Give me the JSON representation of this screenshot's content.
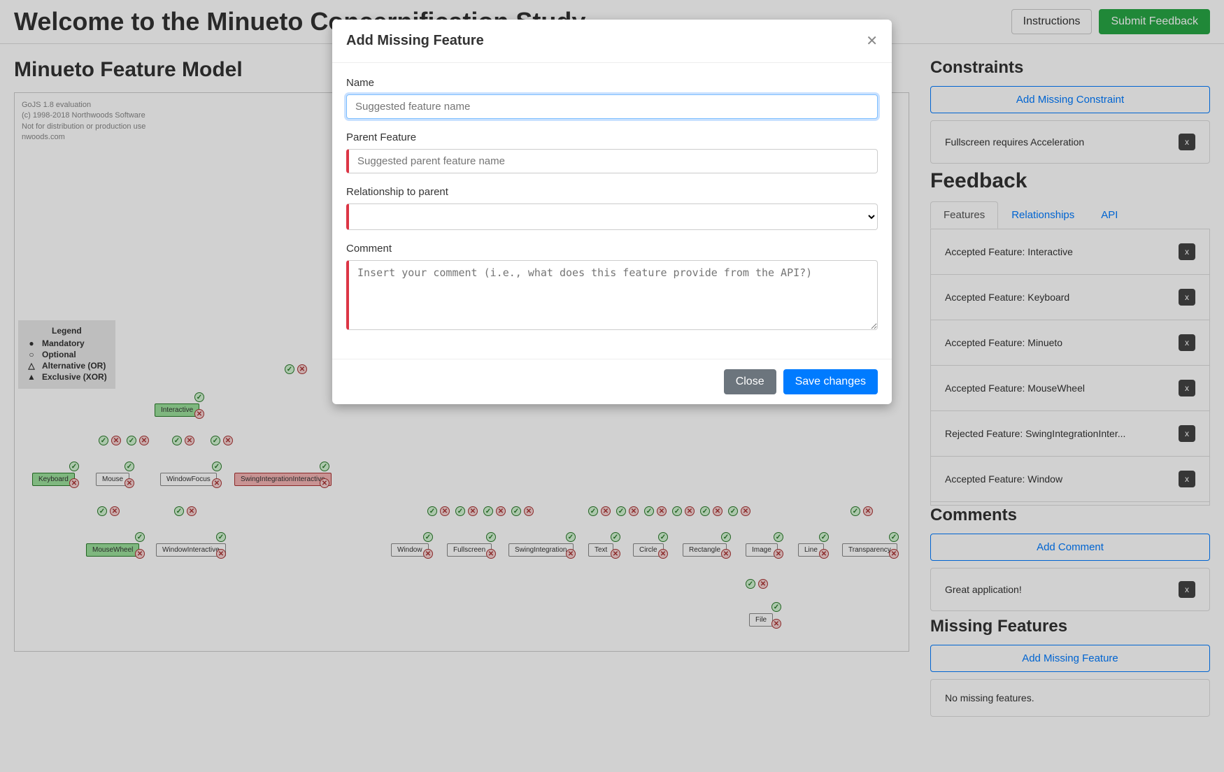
{
  "header": {
    "title": "Welcome to the Minueto Concernification Study",
    "instructions": "Instructions",
    "submit": "Submit Feedback"
  },
  "main": {
    "title": "Minueto Feature Model",
    "watermark": {
      "l1": "GoJS 1.8 evaluation",
      "l2": "(c) 1998-2018 Northwoods Software",
      "l3": "Not for distribution or production use",
      "l4": "nwoods.com"
    },
    "legend": {
      "title": "Legend",
      "mandatory": "Mandatory",
      "optional": "Optional",
      "alternative": "Alternative (OR)",
      "exclusive": "Exclusive (XOR)"
    },
    "nodes": {
      "interactive": "Interactive",
      "keyboard": "Keyboard",
      "mouse": "Mouse",
      "windowfocus": "WindowFocus",
      "swingint_inter": "SwingIntegrationInteractive",
      "mousewheel": "MouseWheel",
      "windowinteractive": "WindowInteractive",
      "window": "Window",
      "fullscreen": "Fullscreen",
      "swingintegration": "SwingIntegration",
      "text": "Text",
      "circle": "Circle",
      "rectangle": "Rectangle",
      "image": "Image",
      "line": "Line",
      "transparency": "Transparency",
      "file": "File"
    }
  },
  "sidebar": {
    "constraints": {
      "title": "Constraints",
      "add": "Add Missing Constraint",
      "items": [
        {
          "text": "Fullscreen requires Acceleration"
        }
      ]
    },
    "feedback": {
      "title": "Feedback",
      "tabs": {
        "features": "Features",
        "relationships": "Relationships",
        "api": "API"
      },
      "items": [
        {
          "text": "Accepted Feature: Interactive"
        },
        {
          "text": "Accepted Feature: Keyboard"
        },
        {
          "text": "Accepted Feature: Minueto"
        },
        {
          "text": "Accepted Feature: MouseWheel"
        },
        {
          "text": "Rejected Feature: SwingIntegrationInter..."
        },
        {
          "text": "Accepted Feature: Window"
        }
      ]
    },
    "comments": {
      "title": "Comments",
      "add": "Add Comment",
      "items": [
        {
          "text": "Great application!"
        }
      ]
    },
    "missing": {
      "title": "Missing Features",
      "add": "Add Missing Feature",
      "empty": "No missing features."
    }
  },
  "modal": {
    "title": "Add Missing Feature",
    "name_label": "Name",
    "name_placeholder": "Suggested feature name",
    "parent_label": "Parent Feature",
    "parent_placeholder": "Suggested parent feature name",
    "relationship_label": "Relationship to parent",
    "comment_label": "Comment",
    "comment_placeholder": "Insert your comment (i.e., what does this feature provide from the API?)",
    "close": "Close",
    "save": "Save changes"
  },
  "delete_x": "x"
}
